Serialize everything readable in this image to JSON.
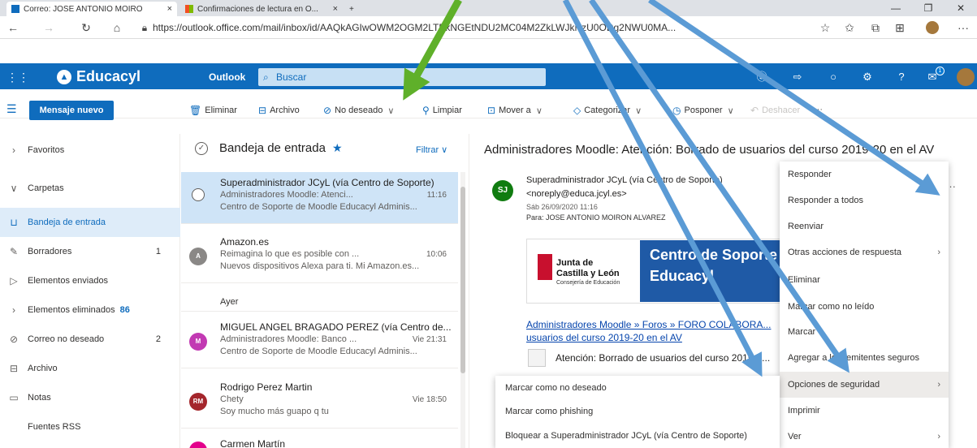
{
  "browser": {
    "tabs": [
      {
        "title": "Correo: JOSE ANTONIO MOIRO",
        "close": "×"
      },
      {
        "title": "Confirmaciones de lectura en O...",
        "close": "×"
      },
      {
        "title": "+",
        "close": ""
      }
    ],
    "url": "https://outlook.office.com/mail/inbox/id/AAQkAGIwOWM2OGM2LTBkNGEtNDU2MC04M2ZkLWJkNzU0ODg2NWU0MA...",
    "window": {
      "minimize": "—",
      "maximize": "❐",
      "close": "✕"
    }
  },
  "header": {
    "brand": "Educacyl",
    "app": "Outlook",
    "search_placeholder": "Buscar",
    "notification_count": "1"
  },
  "toolbar": {
    "new_message": "Mensaje nuevo",
    "delete": "Eliminar",
    "archive": "Archivo",
    "junk": "No deseado",
    "sweep": "Limpiar",
    "move": "Mover a",
    "categorize": "Categorizar",
    "snooze": "Posponer",
    "undo": "Deshacer",
    "more": "···"
  },
  "sidebar": {
    "items": [
      {
        "label": "Favoritos",
        "count": ""
      },
      {
        "label": "Carpetas",
        "count": ""
      },
      {
        "label": "Bandeja de entrada",
        "count": ""
      },
      {
        "label": "Borradores",
        "count": "1"
      },
      {
        "label": "Elementos enviados",
        "count": ""
      },
      {
        "label": "Elementos eliminados",
        "count": "86"
      },
      {
        "label": "Correo no deseado",
        "count": "2"
      },
      {
        "label": "Archivo",
        "count": ""
      },
      {
        "label": "Notas",
        "count": ""
      },
      {
        "label": "Fuentes RSS",
        "count": ""
      }
    ]
  },
  "list": {
    "title": "Bandeja de entrada",
    "star": "★",
    "filter": "Filtrar",
    "day_header": "Ayer",
    "messages": [
      {
        "avatar": "",
        "from": "Superadministrador JCyL (vía Centro de Soporte)",
        "subject": "Administradores Moodle: Atenci...",
        "time": "11:16",
        "preview": "Centro de Soporte de Moodle Educacyl Adminis..."
      },
      {
        "avatar": "A",
        "from": "Amazon.es",
        "subject": "Reimagina lo que es posible con ...",
        "time": "10:06",
        "preview": "Nuevos dispositivos Alexa para ti. Mi Amazon.es..."
      },
      {
        "avatar": "M",
        "from": "MIGUEL ANGEL BRAGADO PEREZ (vía Centro de...",
        "subject": "Administradores Moodle: Banco ...",
        "time": "Vie 21:31",
        "preview": "Centro de Soporte de Moodle Educacyl Adminis..."
      },
      {
        "avatar": "RM",
        "from": "Rodrigo Perez Martin",
        "subject": "Chety",
        "time": "Vie 18:50",
        "preview": "Soy mucho más guapo q tu"
      },
      {
        "avatar": "",
        "from": "Carmen Martín",
        "subject": "",
        "time": "",
        "preview": ""
      }
    ]
  },
  "reading": {
    "title": "Administradores Moodle: Atención: Borrado de usuarios del curso 2019-20 en el AV",
    "sender_initials": "SJ",
    "sender": "Superadministrador JCyL (vía Centro de Soporte)",
    "email": "<noreply@educa.jcyl.es>",
    "date": "Sáb 26/09/2020 11:16",
    "to": "Para:  JOSE ANTONIO MOIRON ALVAREZ",
    "banner_org_1": "Junta de",
    "banner_org_2": "Castilla y León",
    "banner_org_3": "Consejería de Educación",
    "banner_title_1": "Centro de Soporte",
    "banner_title_2": "Educacyl",
    "breadcrumb": "Administradores Moodle » Foros » FORO COLABORA...",
    "breadcrumb_2": "usuarios del curso 2019-20 en el AV",
    "body_line": "Atención: Borrado de usuarios del curso 2019-2...",
    "more": "···"
  },
  "context_menu": {
    "items": [
      {
        "label": "Responder",
        "chevron": ""
      },
      {
        "label": "Responder a todos",
        "chevron": ""
      },
      {
        "label": "Reenviar",
        "chevron": ""
      },
      {
        "label": "Otras acciones de respuesta",
        "chevron": "›"
      },
      {
        "label": "Eliminar",
        "chevron": ""
      },
      {
        "label": "Marcar como no leído",
        "chevron": ""
      },
      {
        "label": "Marcar",
        "chevron": ""
      },
      {
        "label": "Agregar a los remitentes seguros",
        "chevron": ""
      },
      {
        "label": "Opciones de seguridad",
        "chevron": "›"
      },
      {
        "label": "Imprimir",
        "chevron": ""
      },
      {
        "label": "Ver",
        "chevron": "›"
      }
    ]
  },
  "submenu": {
    "items": [
      {
        "label": "Marcar como no deseado"
      },
      {
        "label": "Marcar como phishing"
      },
      {
        "label": "Bloquear a Superadministrador JCyL (vía Centro de Soporte)"
      }
    ]
  },
  "colors": {
    "brand": "#0f6cbd",
    "selected": "#cfe4f7",
    "arrow_green": "#5fb02a",
    "arrow_blue": "#5b9bd5"
  }
}
